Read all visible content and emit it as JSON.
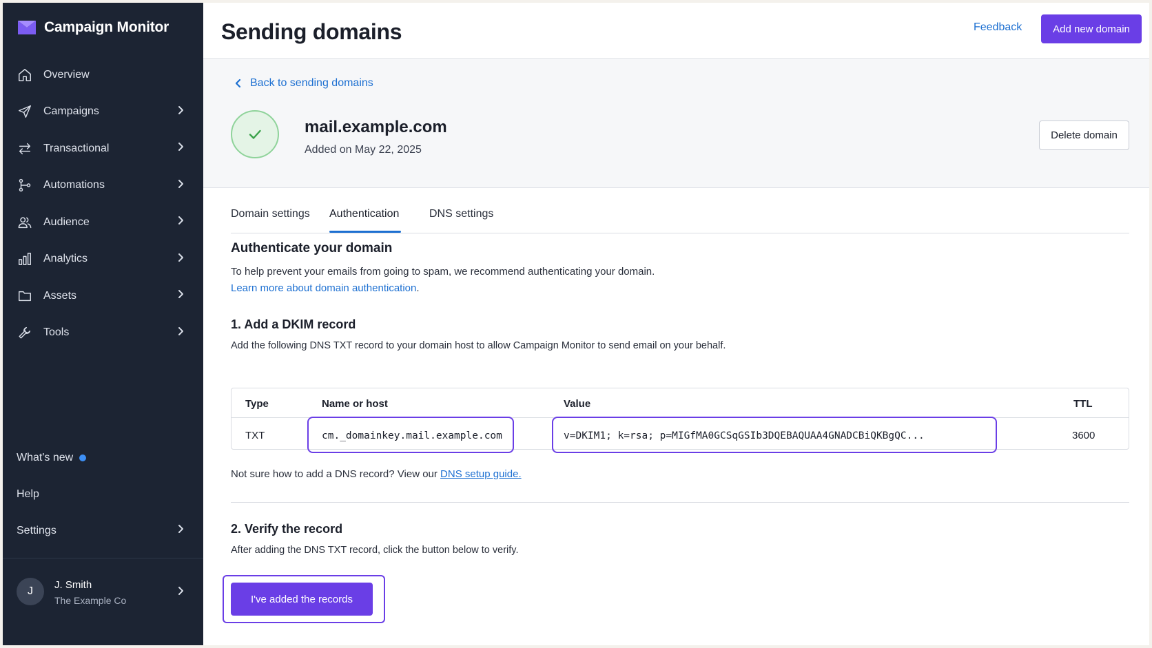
{
  "brand": {
    "name": "Campaign Monitor",
    "logo_icon": "envelope-logo-icon",
    "accent": "#6a3ee6"
  },
  "sidebar": {
    "items": [
      {
        "label": "Overview",
        "icon": "home-icon",
        "has_chevron": false
      },
      {
        "label": "Campaigns",
        "icon": "paper-plane-icon",
        "has_chevron": true
      },
      {
        "label": "Transactional",
        "icon": "arrows-swap-icon",
        "has_chevron": true
      },
      {
        "label": "Automations",
        "icon": "workflow-icon",
        "has_chevron": true
      },
      {
        "label": "Audience",
        "icon": "users-icon",
        "has_chevron": true
      },
      {
        "label": "Analytics",
        "icon": "bar-chart-icon",
        "has_chevron": true
      },
      {
        "label": "Assets",
        "icon": "folder-icon",
        "has_chevron": true
      },
      {
        "label": "Tools",
        "icon": "wrench-icon",
        "has_chevron": true
      }
    ],
    "lower": {
      "whats_new": "What's new",
      "help": "Help",
      "settings": "Settings"
    },
    "user": {
      "initial": "J",
      "name": "J. Smith",
      "org": "The Example Co"
    }
  },
  "header": {
    "title": "Sending domains",
    "feedback": "Feedback",
    "add_button": "Add new domain"
  },
  "domain": {
    "back_link": "Back to sending domains",
    "name": "mail.example.com",
    "added_on": "Added on May 22, 2025",
    "delete_button": "Delete domain",
    "status_icon": "check-icon"
  },
  "tabs": [
    {
      "label": "Domain settings",
      "active": false
    },
    {
      "label": "Authentication",
      "active": true
    },
    {
      "label": "DNS settings",
      "active": false
    }
  ],
  "auth": {
    "heading": "Authenticate your domain",
    "intro": "To help prevent your emails from going to spam, we recommend authenticating your domain.",
    "learn_more": "Learn more about domain authentication",
    "learn_more_suffix": ".",
    "step1_heading": "1. Add a DKIM record",
    "step1_text": "Add the following DNS TXT record to your domain host to allow Campaign Monitor to send email on your behalf.",
    "table": {
      "headers": {
        "type": "Type",
        "name": "Name or host",
        "value": "Value",
        "ttl": "TTL"
      },
      "row": {
        "type": "TXT",
        "name": "cm._domainkey.mail.example.com",
        "value": "v=DKIM1; k=rsa; p=MIGfMA0GCSqGSIb3DQEBAQUAA4GNADCBiQKBgQC...",
        "ttl": "3600"
      }
    },
    "help_prefix": "Not sure how to add a DNS record? View our ",
    "help_link": "DNS setup guide.",
    "step2_heading": "2. Verify the record",
    "step2_text": "After adding the DNS TXT record, click the button below to verify.",
    "verify_button": "I've added the records"
  }
}
